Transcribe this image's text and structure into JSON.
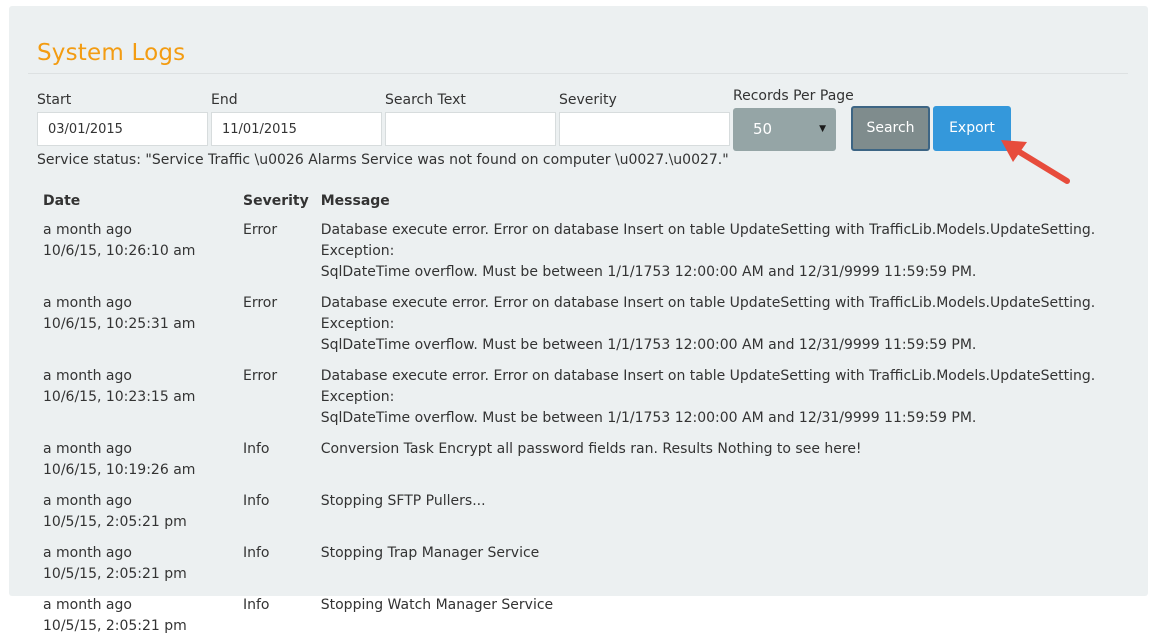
{
  "page": {
    "title": "System Logs"
  },
  "filters": {
    "start_label": "Start",
    "start_value": "03/01/2015",
    "end_label": "End",
    "end_value": "11/01/2015",
    "search_text_label": "Search Text",
    "search_text_value": "",
    "severity_label": "Severity",
    "severity_value": "",
    "records_per_page_label": "Records Per Page",
    "records_per_page_value": "50",
    "search_button": "Search",
    "export_button": "Export"
  },
  "status": {
    "text": "Service status: \"Service Traffic \\u0026 Alarms Service was not found on computer \\u0027.\\u0027.\""
  },
  "table": {
    "headers": {
      "date": "Date",
      "severity": "Severity",
      "message": "Message"
    },
    "rows": [
      {
        "relative": "a month ago",
        "timestamp": "10/6/15, 10:26:10 am",
        "severity": "Error",
        "message_line1": "Database execute error. Error on database Insert on table UpdateSetting with TrafficLib.Models.UpdateSetting. Exception:",
        "message_line2": "SqlDateTime overflow. Must be between 1/1/1753 12:00:00 AM and 12/31/9999 11:59:59 PM."
      },
      {
        "relative": "a month ago",
        "timestamp": "10/6/15, 10:25:31 am",
        "severity": "Error",
        "message_line1": "Database execute error. Error on database Insert on table UpdateSetting with TrafficLib.Models.UpdateSetting. Exception:",
        "message_line2": "SqlDateTime overflow. Must be between 1/1/1753 12:00:00 AM and 12/31/9999 11:59:59 PM."
      },
      {
        "relative": "a month ago",
        "timestamp": "10/6/15, 10:23:15 am",
        "severity": "Error",
        "message_line1": "Database execute error. Error on database Insert on table UpdateSetting with TrafficLib.Models.UpdateSetting. Exception:",
        "message_line2": "SqlDateTime overflow. Must be between 1/1/1753 12:00:00 AM and 12/31/9999 11:59:59 PM."
      },
      {
        "relative": "a month ago",
        "timestamp": "10/6/15, 10:19:26 am",
        "severity": "Info",
        "message_line1": "Conversion Task Encrypt all password fields ran. Results Nothing to see here!",
        "message_line2": ""
      },
      {
        "relative": "a month ago",
        "timestamp": "10/5/15, 2:05:21 pm",
        "severity": "Info",
        "message_line1": "Stopping SFTP Pullers...",
        "message_line2": ""
      },
      {
        "relative": "a month ago",
        "timestamp": "10/5/15, 2:05:21 pm",
        "severity": "Info",
        "message_line1": "Stopping Trap Manager Service",
        "message_line2": ""
      },
      {
        "relative": "a month ago",
        "timestamp": "10/5/15, 2:05:21 pm",
        "severity": "Info",
        "message_line1": "Stopping Watch Manager Service",
        "message_line2": ""
      }
    ]
  },
  "icons": {
    "caret": "caret-down-icon",
    "annotation_arrow": "red-arrow-icon"
  },
  "colors": {
    "panel_bg": "#ecf0f1",
    "title": "#f39c12",
    "select_bg": "#95a5a6",
    "search_button": "#7f8c8d",
    "export_button": "#3498db",
    "annotation_arrow": "#e74c3c"
  }
}
